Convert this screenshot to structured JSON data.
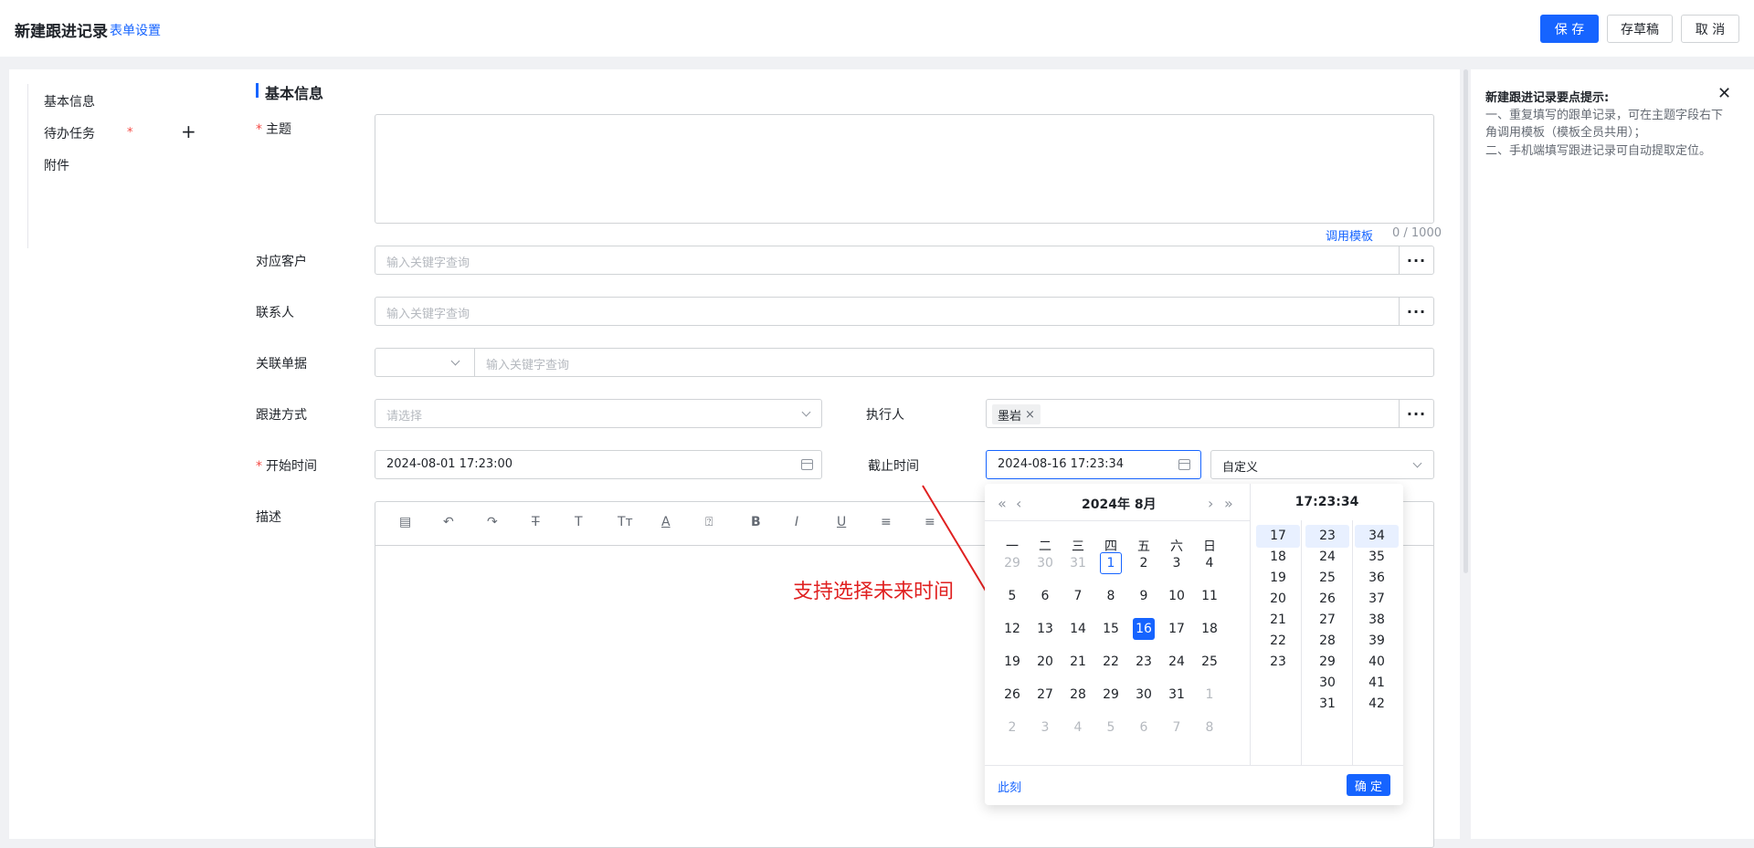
{
  "header": {
    "title": "新建跟进记录",
    "form_settings": "表单设置",
    "save": "保 存",
    "draft": "存草稿",
    "cancel": "取 消"
  },
  "leftnav": {
    "items": [
      "基本信息",
      "待办任务",
      "附件"
    ],
    "required_mark": "*"
  },
  "section": {
    "title": "基本信息"
  },
  "form": {
    "subject_label": "主题",
    "required_mark": "*",
    "template_link": "调用模板",
    "counter": "0 / 1000",
    "customer_label": "对应客户",
    "customer_placeholder": "输入关键字查询",
    "contact_label": "联系人",
    "contact_placeholder": "输入关键字查询",
    "related_label": "关联单据",
    "related_placeholder": "输入关键字查询",
    "method_label": "跟进方式",
    "method_placeholder": "请选择",
    "executor_label": "执行人",
    "executor_tag": "墨岩",
    "start_label": "开始时间",
    "start_value": "2024-08-01 17:23:00",
    "deadline_label": "截止时间",
    "deadline_value": "2024-08-16 17:23:34",
    "custom_value": "自定义",
    "desc_label": "描述"
  },
  "tips": {
    "title": "新建跟进记录要点提示:",
    "lines": [
      "一、重复填写的跟单记录，可在主题字段右下角调用模板（模板全员共用）；",
      "二、手机端填写跟进记录可自动提取定位。"
    ]
  },
  "annotation": {
    "text": "支持选择未来时间"
  },
  "picker": {
    "month_label": "2024年  8月",
    "time_label": "17:23:34",
    "weekdays": [
      "一",
      "二",
      "三",
      "四",
      "五",
      "六",
      "日"
    ],
    "weeks": [
      [
        "29",
        "30",
        "31",
        "1",
        "2",
        "3",
        "4"
      ],
      [
        "5",
        "6",
        "7",
        "8",
        "9",
        "10",
        "11"
      ],
      [
        "12",
        "13",
        "14",
        "15",
        "16",
        "17",
        "18"
      ],
      [
        "19",
        "20",
        "21",
        "22",
        "23",
        "24",
        "25"
      ],
      [
        "26",
        "27",
        "28",
        "29",
        "30",
        "31",
        "1"
      ],
      [
        "2",
        "3",
        "4",
        "5",
        "6",
        "7",
        "8"
      ]
    ],
    "today": "1",
    "selected": "16",
    "hours": [
      "17",
      "18",
      "19",
      "20",
      "21",
      "22",
      "23"
    ],
    "minutes": [
      "23",
      "24",
      "25",
      "26",
      "27",
      "28",
      "29",
      "30",
      "31"
    ],
    "seconds": [
      "34",
      "35",
      "36",
      "37",
      "38",
      "39",
      "40",
      "41",
      "42"
    ],
    "now_label": "此刻",
    "ok_label": "确 定"
  },
  "colors": {
    "primary": "#1664ff",
    "required": "#f54a45",
    "annotation": "#e02020"
  }
}
